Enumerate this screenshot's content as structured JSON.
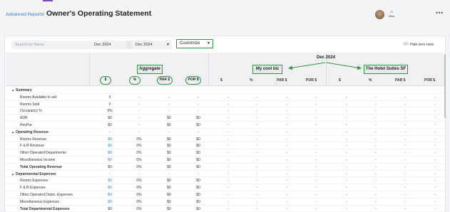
{
  "header": {
    "breadcrumb": "Advanced Reports",
    "separator": "/",
    "title": "Owner's Operating Statement",
    "logo_text": "Hilton",
    "more_label": "•••"
  },
  "filters": {
    "search_placeholder": "Search by Name",
    "date_from": "Dec 2024",
    "date_dash": "-",
    "date_to": "Dec 2024",
    "customize_label": "Customize",
    "hide_zero_label": "Hide zero rows"
  },
  "table": {
    "period_title": "Dec 2024",
    "groups": [
      "Aggregate",
      "My cool biz",
      "The Hotel Suites SF"
    ],
    "columns": [
      "$",
      "%",
      "PAR $",
      "POR $"
    ],
    "rows": [
      {
        "label": "Summary",
        "type": "section",
        "vals": [
          "",
          "",
          "",
          ""
        ]
      },
      {
        "label": "Rooms Available to sell",
        "type": "item",
        "vals": [
          "0",
          "-",
          "-",
          "-"
        ]
      },
      {
        "label": "Rooms Sold",
        "type": "item",
        "vals": [
          "0",
          "-",
          "-",
          "-"
        ]
      },
      {
        "label": "Occupancy %",
        "type": "item",
        "vals": [
          "0%",
          "-",
          "-",
          "-"
        ]
      },
      {
        "label": "ADR",
        "type": "item",
        "vals": [
          "$0",
          "-",
          "$0",
          "$0"
        ]
      },
      {
        "label": "RevPar",
        "type": "item",
        "vals": [
          "$0",
          "-",
          "$0",
          "$0"
        ]
      },
      {
        "label": "Operating Revenue",
        "type": "section",
        "vals": [
          "-",
          "-",
          "-",
          "-"
        ]
      },
      {
        "label": "Rooms Revenue",
        "type": "item",
        "blue": true,
        "vals": [
          "$0",
          "0%",
          "$0",
          "$0"
        ]
      },
      {
        "label": "F & B Revenue",
        "type": "item",
        "blue": true,
        "vals": [
          "$0",
          "0%",
          "$0",
          "$0"
        ]
      },
      {
        "label": "Other Operated Departments",
        "type": "item",
        "blue": true,
        "vals": [
          "$0",
          "0%",
          "$0",
          "$0"
        ]
      },
      {
        "label": "Miscellaneous Income",
        "type": "item",
        "blue": true,
        "vals": [
          "$0",
          "0%",
          "$0",
          "$0"
        ]
      },
      {
        "label": "Total Operating Revenue",
        "type": "total",
        "vals": [
          "$0",
          "0%",
          "$0",
          "$0"
        ]
      },
      {
        "label": "Departmental Expenses",
        "type": "section",
        "vals": [
          "-",
          "-",
          "-",
          "-"
        ]
      },
      {
        "label": "Rooms Expenses",
        "type": "item",
        "blue": true,
        "vals": [
          "$0",
          "0%",
          "$0",
          "$0"
        ]
      },
      {
        "label": "F & B Expenses",
        "type": "item",
        "blue": true,
        "vals": [
          "$0",
          "0%",
          "$0",
          "$0"
        ]
      },
      {
        "label": "Other Operated Depts. Expenses",
        "type": "item",
        "blue": true,
        "vals": [
          "$0",
          "0%",
          "$0",
          "$0"
        ]
      },
      {
        "label": "Miscellaneous Expenses",
        "type": "item",
        "blue": true,
        "vals": [
          "$0",
          "0%",
          "$0",
          "$0"
        ]
      },
      {
        "label": "Total Departmental Expenses",
        "type": "total",
        "vals": [
          "$0",
          "0%",
          "$0",
          "$0"
        ]
      }
    ],
    "other_vals": [
      "-",
      "-",
      "-",
      "-"
    ]
  },
  "colors": {
    "accent_green": "#2e9a3e",
    "link_blue": "#2d7fd3"
  },
  "icons": [
    "avatar",
    "hilton-logo-icon",
    "more-icon",
    "chevron-down-icon",
    "collapse-triangle-icon"
  ]
}
